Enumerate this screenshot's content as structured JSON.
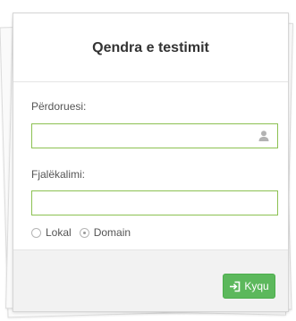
{
  "form": {
    "title": "Qendra e testimit",
    "username_label": "Përdoruesi:",
    "username_value": "",
    "password_label": "Fjalëkalimi:",
    "password_value": "",
    "auth_options": [
      {
        "label": "Lokal",
        "selected": false
      },
      {
        "label": "Domain",
        "selected": true
      }
    ],
    "login_label": "Kyqu"
  },
  "icons": {
    "username": "user-icon",
    "login": "sign-in-icon"
  },
  "colors": {
    "field_border": "#8cc152",
    "button": "#5cb85c"
  }
}
